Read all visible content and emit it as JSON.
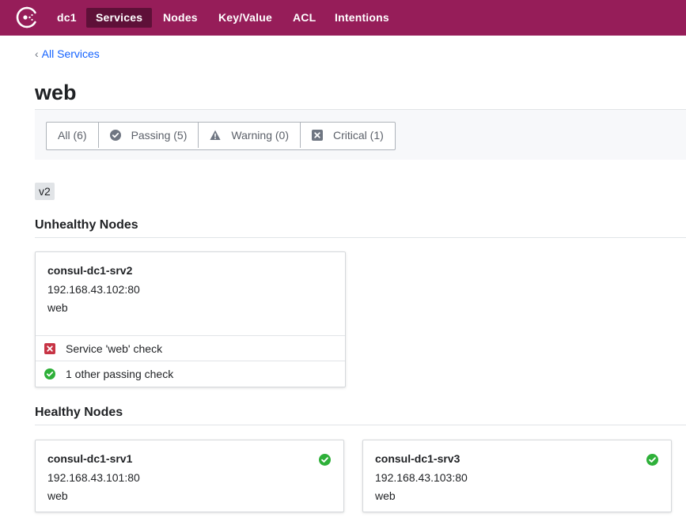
{
  "nav": {
    "datacenter": "dc1",
    "items": [
      {
        "label": "Services",
        "active": true
      },
      {
        "label": "Nodes",
        "active": false
      },
      {
        "label": "Key/Value",
        "active": false
      },
      {
        "label": "ACL",
        "active": false
      },
      {
        "label": "Intentions",
        "active": false
      }
    ],
    "logo_icon": "consul-logo-icon",
    "brand_color": "#961d59"
  },
  "breadcrumb": {
    "label": "All Services"
  },
  "page": {
    "title": "web"
  },
  "filters": [
    {
      "label": "All (6)",
      "icon": null
    },
    {
      "label": "Passing (5)",
      "icon": "passing-check-icon"
    },
    {
      "label": "Warning (0)",
      "icon": "warning-icon"
    },
    {
      "label": "Critical (1)",
      "icon": "critical-x-icon"
    }
  ],
  "tags": [
    "v2"
  ],
  "unhealthy": {
    "heading": "Unhealthy Nodes",
    "nodes": [
      {
        "name": "consul-dc1-srv2",
        "address": "192.168.43.102:80",
        "service": "web",
        "checks": [
          {
            "label": "Service 'web' check",
            "status": "critical"
          },
          {
            "label": "1 other passing check",
            "status": "passing"
          }
        ]
      }
    ]
  },
  "healthy": {
    "heading": "Healthy Nodes",
    "nodes": [
      {
        "name": "consul-dc1-srv1",
        "address": "192.168.43.101:80",
        "service": "web",
        "status": "passing"
      },
      {
        "name": "consul-dc1-srv3",
        "address": "192.168.43.103:80",
        "service": "web",
        "status": "passing"
      }
    ]
  },
  "colors": {
    "passing": "#2eb039",
    "critical": "#c73445",
    "link": "#1563ff"
  }
}
